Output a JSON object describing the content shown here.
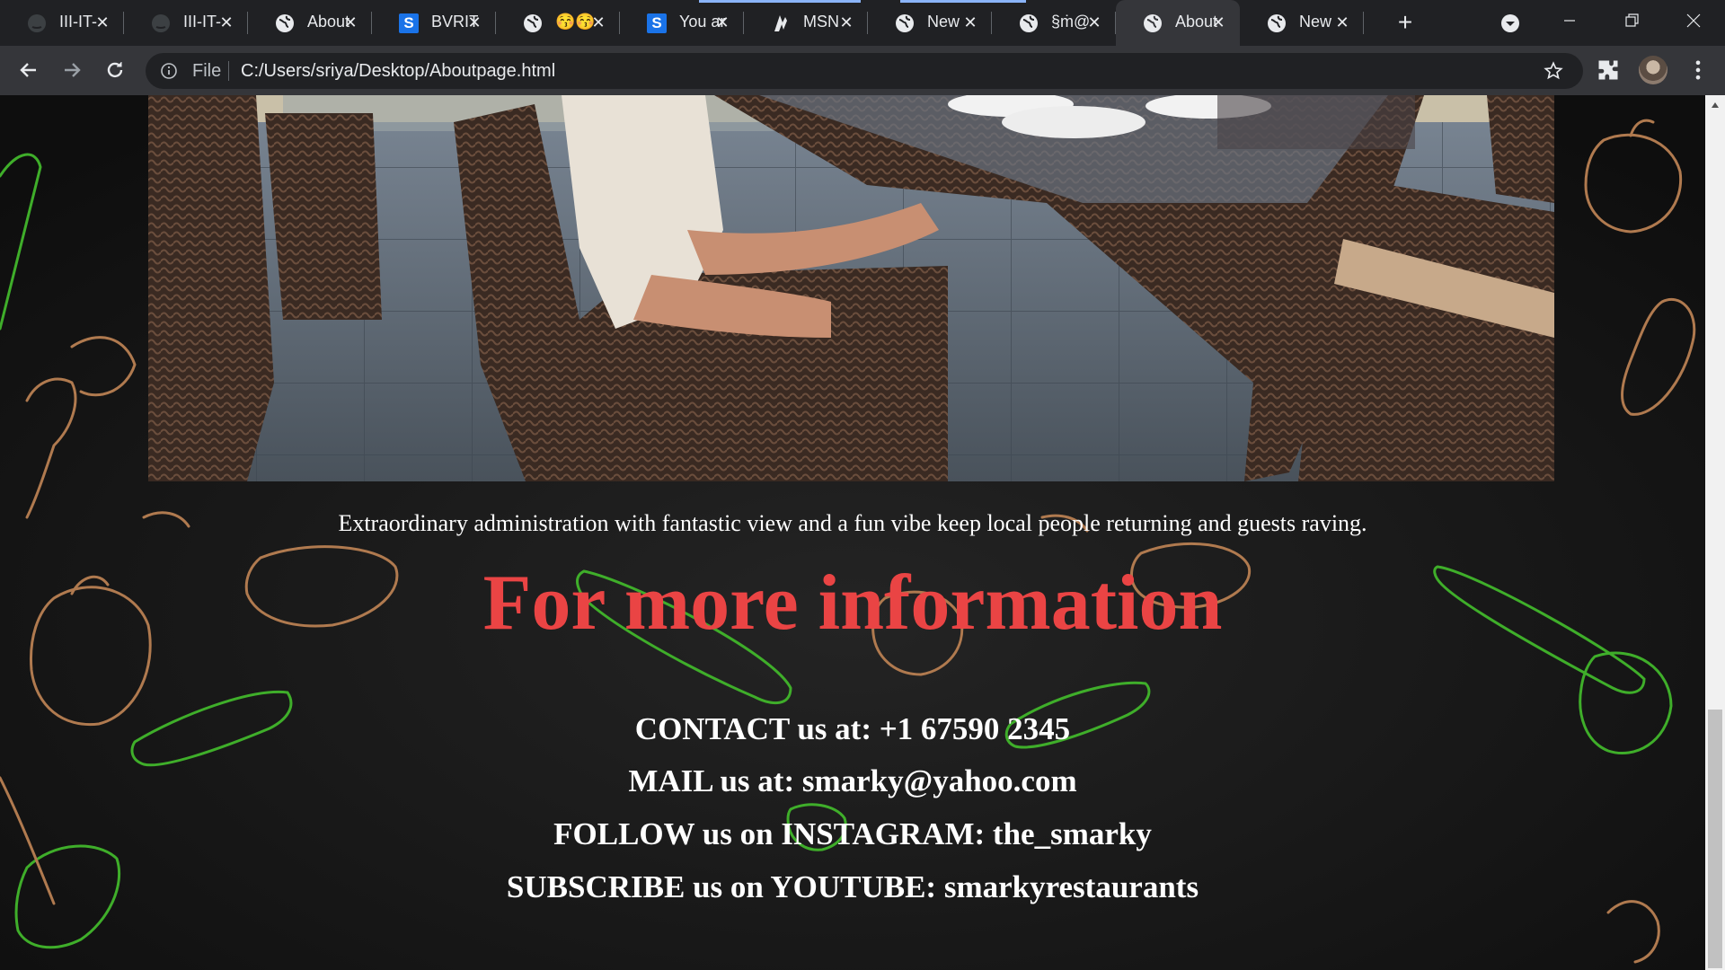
{
  "browser": {
    "tabs": [
      {
        "title": "III-IT-",
        "icon": "github-icon"
      },
      {
        "title": "III-IT-",
        "icon": "github-icon"
      },
      {
        "title": "About",
        "icon": "globe-icon"
      },
      {
        "title": "BVRIT",
        "icon": "s-logo-icon"
      },
      {
        "title": "😚😚",
        "icon": "globe-icon"
      },
      {
        "title": "You are",
        "icon": "s-logo-icon"
      },
      {
        "title": "MSN",
        "icon": "msn-icon"
      },
      {
        "title": "New",
        "icon": "globe-icon"
      },
      {
        "title": "§ṁ@",
        "icon": "globe-icon"
      },
      {
        "title": "About",
        "icon": "globe-icon",
        "active": true
      },
      {
        "title": "New",
        "icon": "globe-icon"
      }
    ],
    "new_tab": "+",
    "address": {
      "scheme_label": "File",
      "url": "C:/Users/sriya/Desktop/Aboutpage.html"
    }
  },
  "page": {
    "caption": "Extraordinary administration with fantastic view and a fun vibe keep local people returning and guests raving.",
    "headline": "For more information",
    "contact_lines": [
      "CONTACT us at: +1 67590 2345",
      "MAIL us at: smarky@yahoo.com",
      "FOLLOW us on INSTAGRAM: the_smarky",
      "SUBSCRIBE us on YOUTUBE: smarkyrestaurants"
    ]
  },
  "colors": {
    "chrome_dark": "#202124",
    "chrome_toolbar": "#35363a",
    "headline_red": "#ea4444",
    "page_bg": "#161616",
    "veg_green": "#3fae2a",
    "veg_tan": "#b07a4f"
  }
}
